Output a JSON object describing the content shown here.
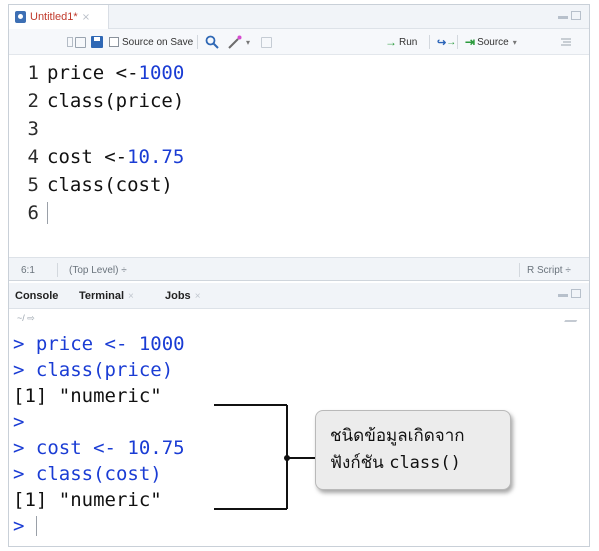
{
  "editor": {
    "tab_title": "Untitled1*",
    "tab_close": "×",
    "toolbar": {
      "source_on_save_label": "Source on Save",
      "run_label": "Run",
      "source_label": "Source",
      "dropdown_caret": "▾",
      "wand_caret": "▾"
    },
    "lines": [
      {
        "num": "1",
        "code": "price <- ",
        "value": "1000",
        "rest": ""
      },
      {
        "num": "2",
        "code": "class(price)",
        "value": "",
        "rest": ""
      },
      {
        "num": "3",
        "code": "",
        "value": "",
        "rest": ""
      },
      {
        "num": "4",
        "code": "cost <- ",
        "value": "10.75",
        "rest": ""
      },
      {
        "num": "5",
        "code": "class(cost)",
        "value": "",
        "rest": ""
      },
      {
        "num": "6",
        "code": "",
        "value": "",
        "rest": ""
      }
    ],
    "status": {
      "position": "6:1",
      "scope": "(Top Level) ÷",
      "file_type": "R Script ÷"
    }
  },
  "console_panel": {
    "tabs": [
      {
        "label": "Console",
        "close": ""
      },
      {
        "label": "Terminal",
        "close": "×"
      },
      {
        "label": "Jobs",
        "close": "×"
      }
    ],
    "path": "~/ ⇨",
    "lines": [
      {
        "prompt": "> ",
        "text": "price <- 1000",
        "kind": "in"
      },
      {
        "prompt": "> ",
        "text": "class(price)",
        "kind": "in"
      },
      {
        "prompt": "",
        "text": "[1] \"numeric\"",
        "kind": "out"
      },
      {
        "prompt": ">",
        "text": "",
        "kind": "in"
      },
      {
        "prompt": "> ",
        "text": "cost <- 10.75",
        "kind": "in"
      },
      {
        "prompt": "> ",
        "text": "class(cost)",
        "kind": "in"
      },
      {
        "prompt": "",
        "text": "[1] \"numeric\"",
        "kind": "out"
      },
      {
        "prompt": "> ",
        "text": "",
        "kind": "in"
      }
    ]
  },
  "annotation": {
    "line1": "ชนิดข้อมูลเกิดจาก",
    "line2_text": "ฟังก์ชัน ",
    "line2_code": "class()"
  },
  "colors": {
    "code_number": "#1a3cd4",
    "console_input": "#1a3cd4",
    "tab_title": "#c0392b"
  }
}
